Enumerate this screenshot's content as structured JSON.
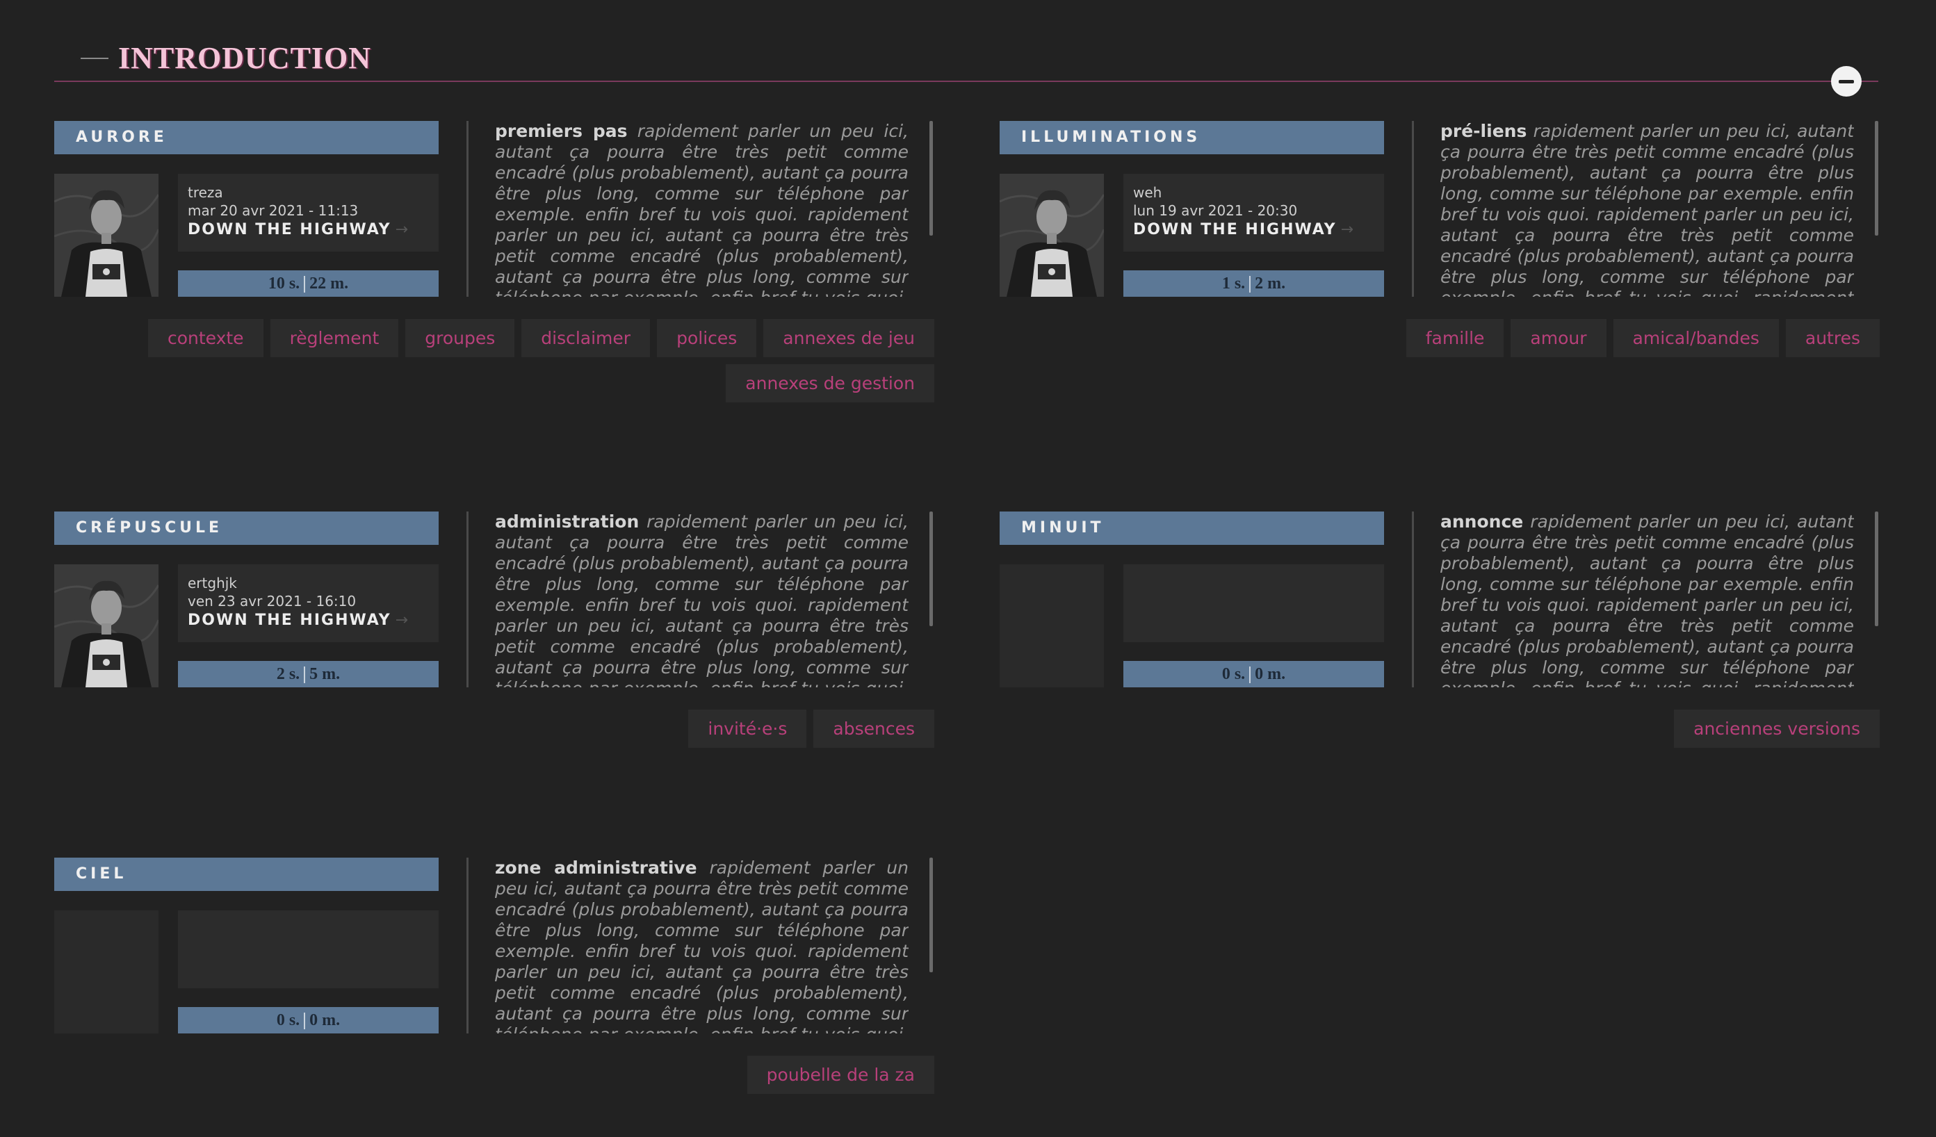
{
  "category": {
    "title": "INTRODUCTION",
    "collapse_icon": "minus-circle-icon"
  },
  "forums": [
    {
      "title": "AURORE",
      "has_avatar": true,
      "last_post": {
        "user": "treza",
        "date": "mar 20 avr 2021 - 11:13",
        "topic": "DOWN THE HIGHWAY",
        "arrow": "→"
      },
      "stats": {
        "subjects": "10 s.",
        "messages": "22 m."
      },
      "desc_lead": "premiers pas",
      "desc": "rapidement parler un peu ici, autant ça pourra être très petit comme encadré (plus probablement), autant ça pourra être plus long, comme sur téléphone par exemple. enfin bref tu vois quoi. rapidement parler un peu ici, autant ça pourra être très petit comme encadré (plus probablement), autant ça pourra être plus long, comme sur téléphone par exemple. enfin bref tu vois quoi. rapidement parler un peu ici, autant ça",
      "subforums": [
        "contexte",
        "règlement",
        "groupes",
        "disclaimer",
        "polices",
        "annexes de jeu",
        "annexes de gestion"
      ]
    },
    {
      "title": "ILLUMINATIONS",
      "has_avatar": true,
      "last_post": {
        "user": "weh",
        "date": "lun 19 avr 2021 - 20:30",
        "topic": "DOWN THE HIGHWAY",
        "arrow": "→"
      },
      "stats": {
        "subjects": "1 s.",
        "messages": "2 m."
      },
      "desc_lead": "pré-liens",
      "desc": "rapidement parler un peu ici, autant ça pourra être très petit comme encadré (plus probablement), autant ça pourra être plus long, comme sur téléphone par exemple. enfin bref tu vois quoi. rapidement parler un peu ici, autant ça pourra être très petit comme encadré (plus probablement), autant ça pourra être plus long, comme sur téléphone par exemple. enfin bref tu vois quoi. rapidement parler un peu ici, autant ça",
      "subforums": [
        "famille",
        "amour",
        "amical/bandes",
        "autres"
      ]
    },
    {
      "title": "CRÉPUSCULE",
      "has_avatar": true,
      "last_post": {
        "user": "ertghjk",
        "date": "ven 23 avr 2021 - 16:10",
        "topic": "DOWN THE HIGHWAY",
        "arrow": "→"
      },
      "stats": {
        "subjects": "2 s.",
        "messages": "5 m."
      },
      "desc_lead": "administration",
      "desc": "rapidement parler un peu ici, autant ça pourra être très petit comme encadré (plus probablement), autant ça pourra être plus long, comme sur téléphone par exemple. enfin bref tu vois quoi. rapidement parler un peu ici, autant ça pourra être très petit comme encadré (plus probablement), autant ça pourra être plus long, comme sur téléphone par exemple. enfin bref tu vois quoi. rapidement parler un peu ici, autant ça",
      "subforums": [
        "invité·e·s",
        "absences"
      ]
    },
    {
      "title": "MINUIT",
      "has_avatar": false,
      "last_post": {
        "user": "",
        "date": "",
        "topic": "",
        "arrow": ""
      },
      "stats": {
        "subjects": "0 s.",
        "messages": "0 m."
      },
      "desc_lead": "annonce",
      "desc": "rapidement parler un peu ici, autant ça pourra être très petit comme encadré (plus probablement), autant ça pourra être plus long, comme sur téléphone par exemple. enfin bref tu vois quoi. rapidement parler un peu ici, autant ça pourra être très petit comme encadré (plus probablement), autant ça pourra être plus long, comme sur téléphone par exemple. enfin bref tu vois quoi. rapidement parler un peu ici, autant ça",
      "subforums": [
        "anciennes versions"
      ]
    },
    {
      "title": "CIEL",
      "has_avatar": false,
      "last_post": {
        "user": "",
        "date": "",
        "topic": "",
        "arrow": ""
      },
      "stats": {
        "subjects": "0 s.",
        "messages": "0 m."
      },
      "desc_lead": "zone administrative",
      "desc": "rapidement parler un peu ici, autant ça pourra être très petit comme encadré (plus probablement), autant ça pourra être plus long, comme sur téléphone par exemple. enfin bref tu vois quoi. rapidement parler un peu ici, autant ça pourra être très petit comme encadré (plus probablement), autant ça pourra être plus long, comme sur téléphone par exemple. enfin bref tu vois quoi. rapidement parler un peu ici, autant ça",
      "subforums": [
        "poubelle de la za"
      ]
    }
  ],
  "colors": {
    "background": "#222222",
    "title_bar": "#5c7896",
    "accent_pink": "#b8407a",
    "header_pink": "#f4c4d8",
    "panel": "#2c2c2c"
  }
}
